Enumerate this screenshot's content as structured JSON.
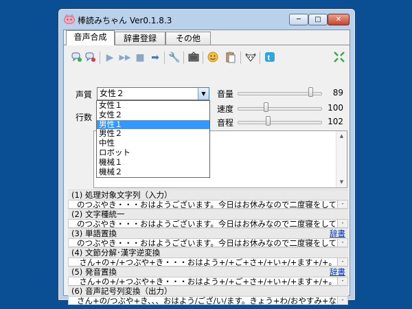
{
  "window": {
    "title": "棒読みちゃん Ver0.1.8.3"
  },
  "tabs": [
    {
      "label": "音声合成"
    },
    {
      "label": "辞書登録"
    },
    {
      "label": "その他"
    }
  ],
  "voice": {
    "label": "声質",
    "selected": "女性２",
    "options": [
      "女性１",
      "女性２",
      "男性１",
      "男性２",
      "中性",
      "ロボット",
      "機械１",
      "機械２"
    ],
    "highlighted": "男性１"
  },
  "lines_label": "行数",
  "sliders": [
    {
      "label": "音量",
      "value": "89",
      "fraction": 0.89
    },
    {
      "label": "速度",
      "value": "100",
      "fraction": 0.33
    },
    {
      "label": "音程",
      "value": "102",
      "fraction": 0.35
    }
  ],
  "steps": [
    {
      "title": "(1) 処理対象文字列（入力）",
      "link": "",
      "value": "のつぶやき・・・おはようございます。今日はお休みなので二度寝をして"
    },
    {
      "title": "(2) 文字種統一",
      "link": "",
      "value": "のつぶやき・・・おはようございます。今日はお休みなので二度寝をして"
    },
    {
      "title": "(3) 単語置換",
      "link": "辞書",
      "value": "のつぶやき・・・おはようございます。今日はお休みなので二度寝をして"
    },
    {
      "title": "(4) 文節分解･漢字逆変換",
      "link": "",
      "value": "さん+の+/+つぶや+き・・・おはよう+/+ご+さ+/+い+/+ます+/+。"
    },
    {
      "title": "(5) 発音置換",
      "link": "辞書",
      "value": "さん+の+/+つぶや+き・・・おはよう+/+ご+さ+/+い+/+ます+/+。"
    },
    {
      "title": "(6) 音声記号列変換（出力）",
      "link": "",
      "value": "さん+の/つぶや+き、、、おはよう/ござ/い/ます。きょう+わ/おやすみ+な"
    }
  ]
}
